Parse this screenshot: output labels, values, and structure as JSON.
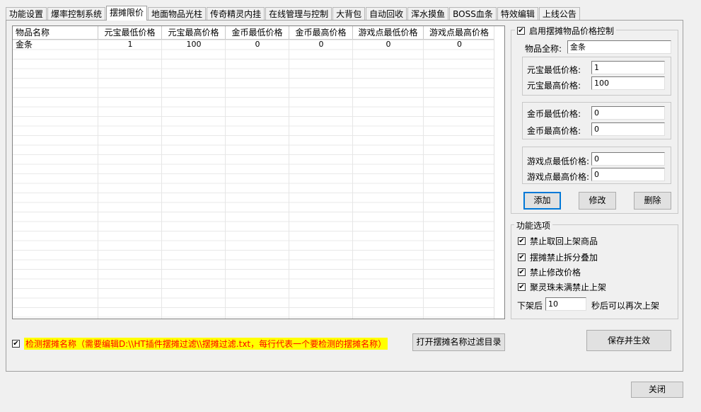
{
  "tabs": [
    {
      "label": "功能设置"
    },
    {
      "label": "爆率控制系统"
    },
    {
      "label": "摆摊限价",
      "active": true
    },
    {
      "label": "地面物品光柱"
    },
    {
      "label": "传奇精灵内挂"
    },
    {
      "label": "在线管理与控制"
    },
    {
      "label": "大背包"
    },
    {
      "label": "自动回收"
    },
    {
      "label": "浑水摸鱼"
    },
    {
      "label": "BOSS血条"
    },
    {
      "label": "特效编辑"
    },
    {
      "label": "上线公告"
    }
  ],
  "grid": {
    "columns": [
      "物品名称",
      "元宝最低价格",
      "元宝最高价格",
      "金币最低价格",
      "金币最高价格",
      "游戏点最低价格",
      "游戏点最高价格"
    ],
    "rows": [
      [
        "金条",
        "1",
        "100",
        "0",
        "0",
        "0",
        "0"
      ]
    ]
  },
  "price_control": {
    "enable_label": "启用摆摊物品价格控制",
    "enabled": true,
    "item_name_label": "物品全称:",
    "item_name_value": "金条",
    "yuanbao_min_label": "元宝最低价格:",
    "yuanbao_min_value": "1",
    "yuanbao_max_label": "元宝最高价格:",
    "yuanbao_max_value": "100",
    "gold_min_label": "金币最低价格:",
    "gold_min_value": "0",
    "gold_max_label": "金币最高价格:",
    "gold_max_value": "0",
    "points_min_label": "游戏点最低价格:",
    "points_min_value": "0",
    "points_max_label": "游戏点最高价格:",
    "points_max_value": "0",
    "add_button": "添加",
    "modify_button": "修改",
    "delete_button": "删除"
  },
  "options": {
    "title": "功能选项",
    "items": [
      {
        "label": "禁止取回上架商品",
        "checked": true
      },
      {
        "label": "摆摊禁止拆分叠加",
        "checked": true
      },
      {
        "label": "禁止修改价格",
        "checked": true
      },
      {
        "label": "聚灵珠未满禁止上架",
        "checked": true
      }
    ],
    "relist_prefix": "下架后",
    "relist_value": "10",
    "relist_suffix": "秒后可以再次上架"
  },
  "name_filter": {
    "checked": true,
    "label": "检测摆摊名称（需要编辑D:\\\\HT插件摆摊过滤\\\\摆摊过滤.txt，每行代表一个要检测的摆摊名称）",
    "open_dir_button": "打开摆摊名称过滤目录"
  },
  "save_button": "保存并生效",
  "close_button": "关闭",
  "check_glyph": "✔"
}
